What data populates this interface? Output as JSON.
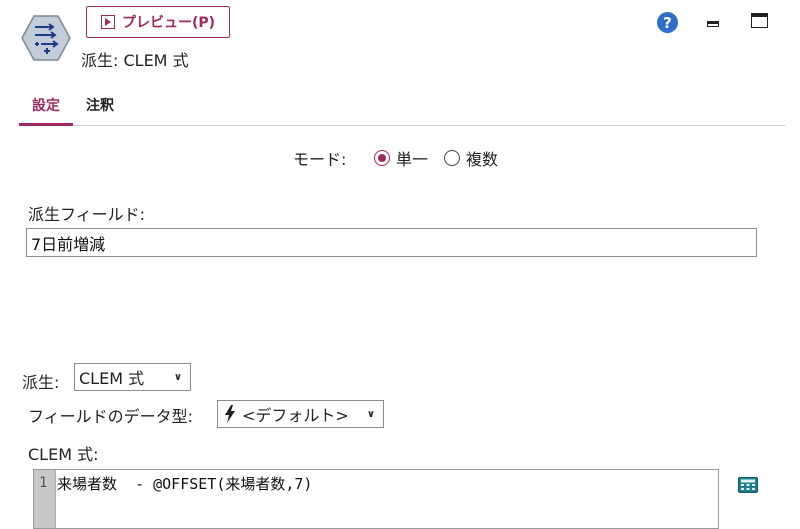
{
  "header": {
    "preview_label": "プレビュー(P)",
    "title": "派生: CLEM 式",
    "icons": [
      "derive-node-icon",
      "play-icon",
      "help-icon",
      "minimize-icon",
      "maximize-icon"
    ],
    "help_glyph": "?"
  },
  "tabs": [
    {
      "label": "設定",
      "active": true
    },
    {
      "label": "注釈",
      "active": false
    }
  ],
  "mode": {
    "label": "モード:",
    "options": [
      {
        "label": "単一",
        "checked": true
      },
      {
        "label": "複数",
        "checked": false
      }
    ]
  },
  "derive_field": {
    "label": "派生フィールド:",
    "value": "7日前増減"
  },
  "derive_as": {
    "label": "派生:",
    "value": "CLEM 式"
  },
  "field_type": {
    "label": "フィールドのデータ型:",
    "value": "<デフォルト>",
    "icon": "bolt-icon"
  },
  "expression": {
    "label": "CLEM 式:",
    "line_number": "1",
    "code": "来場者数  - @OFFSET(来場者数,7)",
    "calculator_icon": "calculator-icon"
  },
  "colors": {
    "accent": "#a0295f",
    "help": "#2f6fc9",
    "node_icon_bg": "#c3ccd9",
    "calculator": "#1f7f8f"
  }
}
